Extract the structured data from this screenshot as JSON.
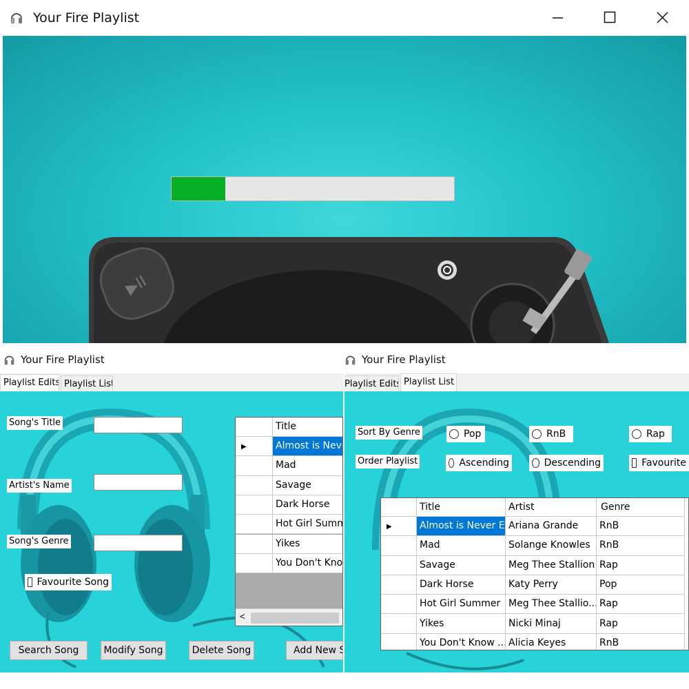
{
  "main_window": {
    "title": "Your Fire Playlist",
    "progress": 0.19
  },
  "edits_window": {
    "title": "Your Fire Playlist",
    "tabs": [
      "Playlist Edits",
      "Playlist List"
    ],
    "labels": {
      "song_title": "Song's Title",
      "artist_name": "Artist's Name",
      "song_genre": "Song's Genre",
      "favourite": "Favourite Song"
    },
    "grid": {
      "header": "Title",
      "rows": [
        "Almost is Never",
        "Mad",
        "Savage",
        "Dark Horse",
        "Hot Girl Summer",
        "Yikes",
        "You Don't Know"
      ],
      "selected_index": 0,
      "scroll_left": "<"
    },
    "buttons": {
      "search": "Search Song",
      "modify": "Modify Song",
      "delete": "Delete Song",
      "add": "Add New So"
    }
  },
  "list_window": {
    "title": "Your Fire Playlist",
    "tabs": [
      "Playlist Edits",
      "Playlist List"
    ],
    "sort_label": "Sort By Genre",
    "order_label": "Order Playlist",
    "sort_options": [
      "Pop",
      "RnB",
      "Rap"
    ],
    "order_options": [
      "Ascending",
      "Descending"
    ],
    "favourite": "Favourite",
    "columns": [
      "Title",
      "Artist",
      "Genre"
    ],
    "rows": [
      [
        "Almost is Never E...",
        "Ariana Grande",
        "RnB"
      ],
      [
        "Mad",
        "Solange Knowles",
        "RnB"
      ],
      [
        "Savage",
        "Meg Thee Stallion",
        "Rap"
      ],
      [
        "Dark Horse",
        "Katy Perry",
        "Pop"
      ],
      [
        "Hot Girl Summer",
        "Meg Thee Stallio...",
        "Rap"
      ],
      [
        "Yikes",
        "Nicki Minaj",
        "Rap"
      ],
      [
        "You Don't Know ...",
        "Alicia Keyes",
        "RnB"
      ]
    ],
    "selected_index": 0
  },
  "colors": {
    "teal": "#27d3d8",
    "progress_fill": "#06b025",
    "selection": "#0078d7"
  }
}
